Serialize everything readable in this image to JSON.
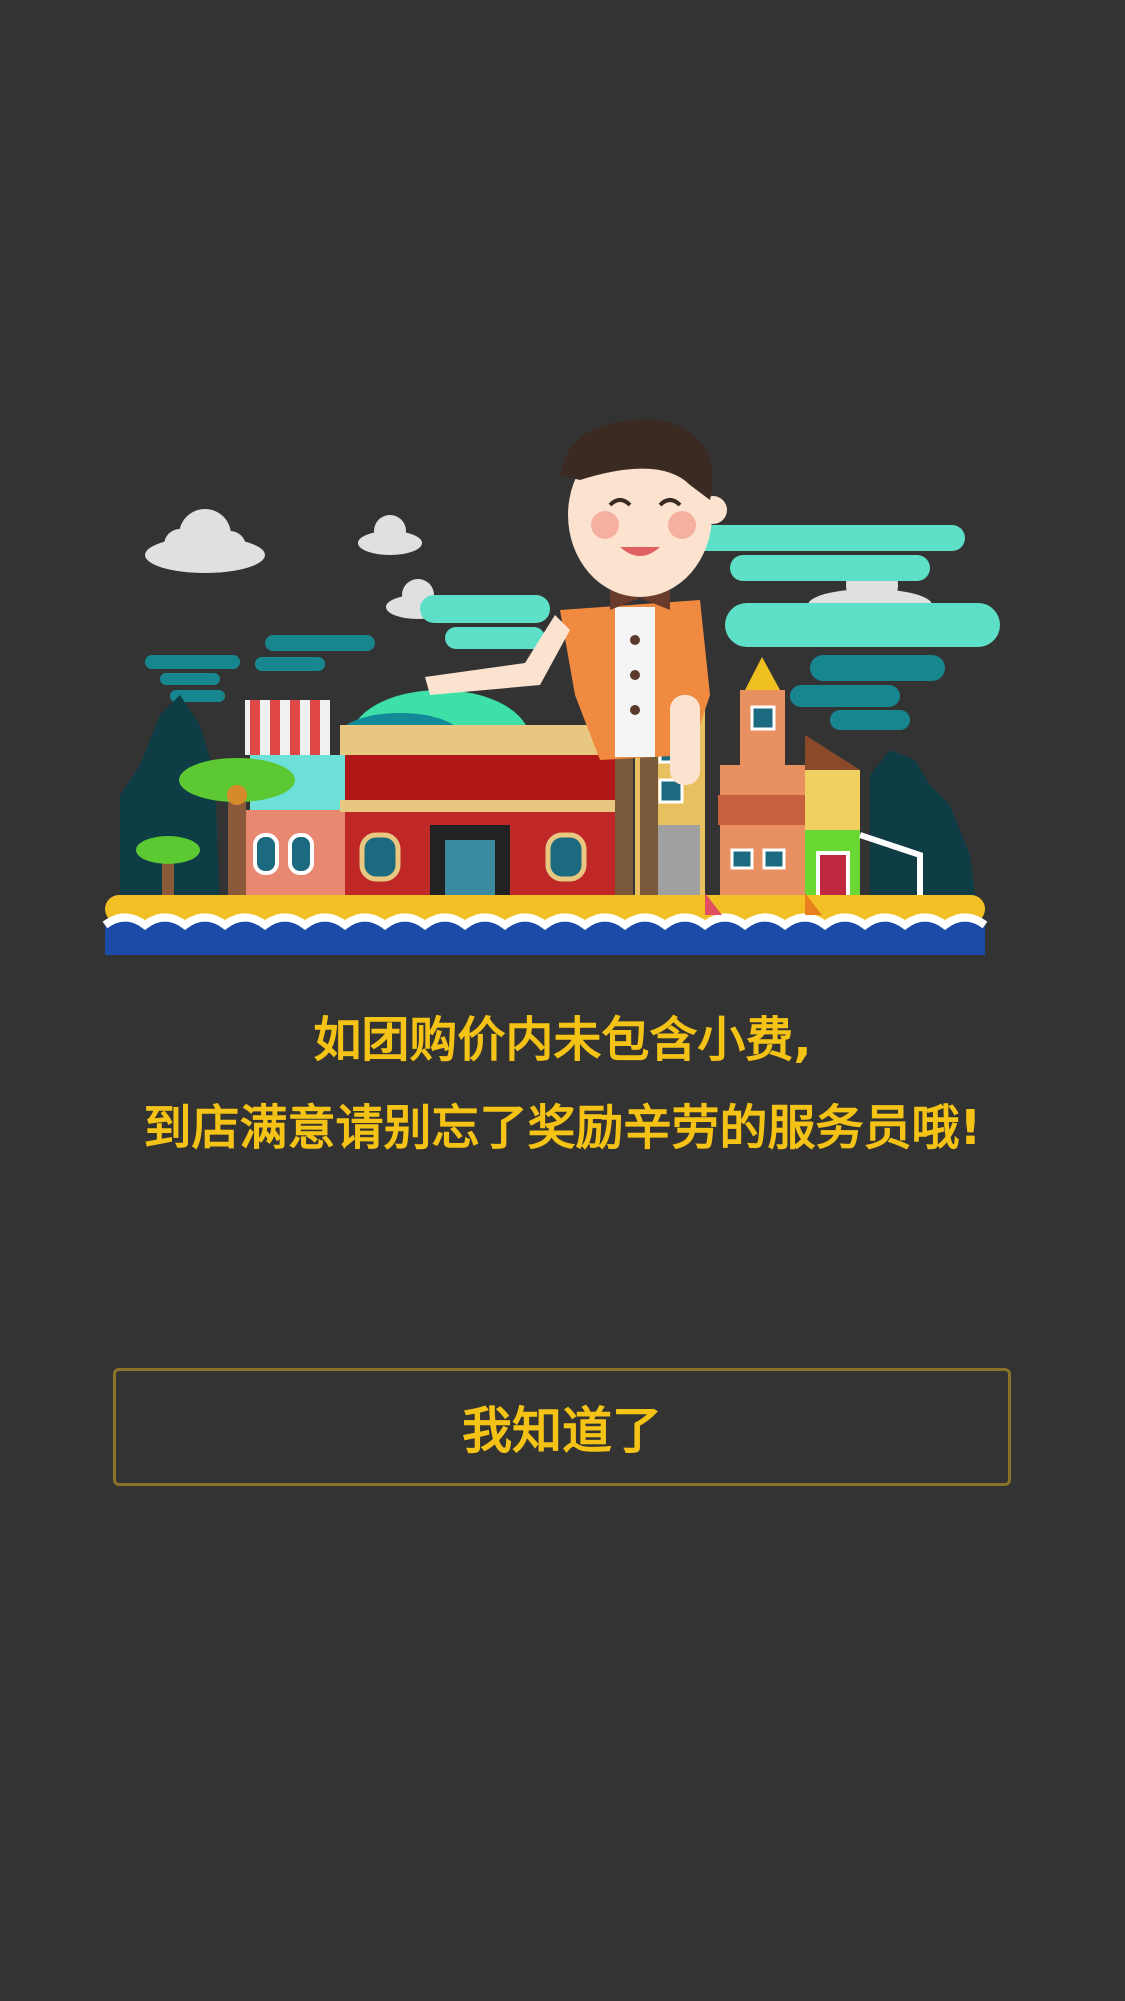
{
  "tip_notice": {
    "line1": "如团购价内未包含小费,",
    "line2": "到店满意请别忘了奖励辛劳的服务员哦!",
    "button_label": "我知道了"
  },
  "illustration": {
    "icon": "waiter-street-illustration"
  },
  "colors": {
    "background": "#333333",
    "accent": "#f5c316",
    "button_border": "#8a7226"
  }
}
